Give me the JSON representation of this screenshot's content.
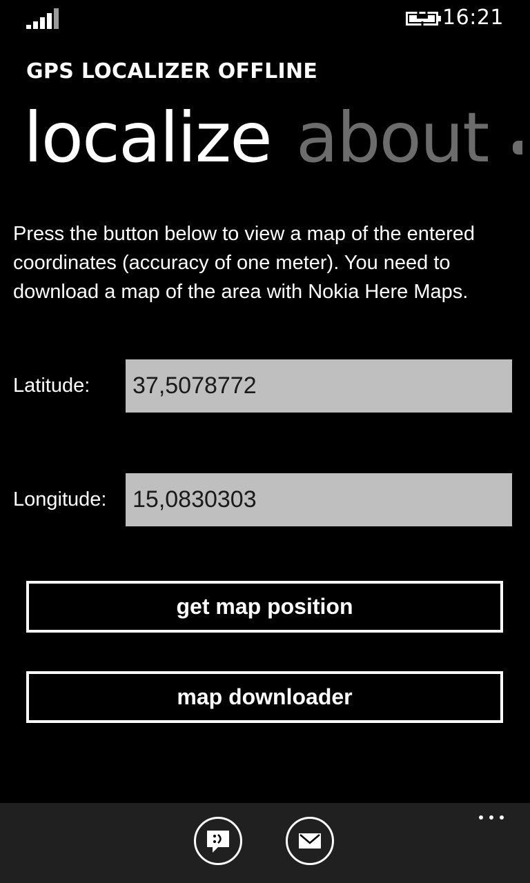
{
  "status_bar": {
    "time": "16:21",
    "signal_icon": "signal-strength-icon",
    "battery_icon": "battery-charging-icon"
  },
  "app": {
    "title": "GPS LOCALIZER OFFLINE"
  },
  "pivot": {
    "items": [
      {
        "label": "localize",
        "active": true
      },
      {
        "label": "about",
        "active": false
      }
    ]
  },
  "description": "Press the button below to view a map of the entered coordinates (accuracy of one meter). You need to download a map of the area with Nokia Here Maps.",
  "form": {
    "latitude_label": "Latitude:",
    "latitude_value": "37,5078772",
    "longitude_label": "Longitude:",
    "longitude_value": "15,0830303"
  },
  "buttons": {
    "get_map_position": "get map position",
    "map_downloader": "map downloader"
  },
  "app_bar": {
    "buttons": [
      {
        "icon": "feedback-smiley-icon"
      },
      {
        "icon": "mail-envelope-icon"
      }
    ],
    "more_icon": "more-ellipsis-icon"
  },
  "colors": {
    "background": "#000000",
    "text": "#ffffff",
    "inactive_pivot": "#6c6c6c",
    "input_background": "#bfbfbf",
    "app_bar_background": "#202020"
  }
}
